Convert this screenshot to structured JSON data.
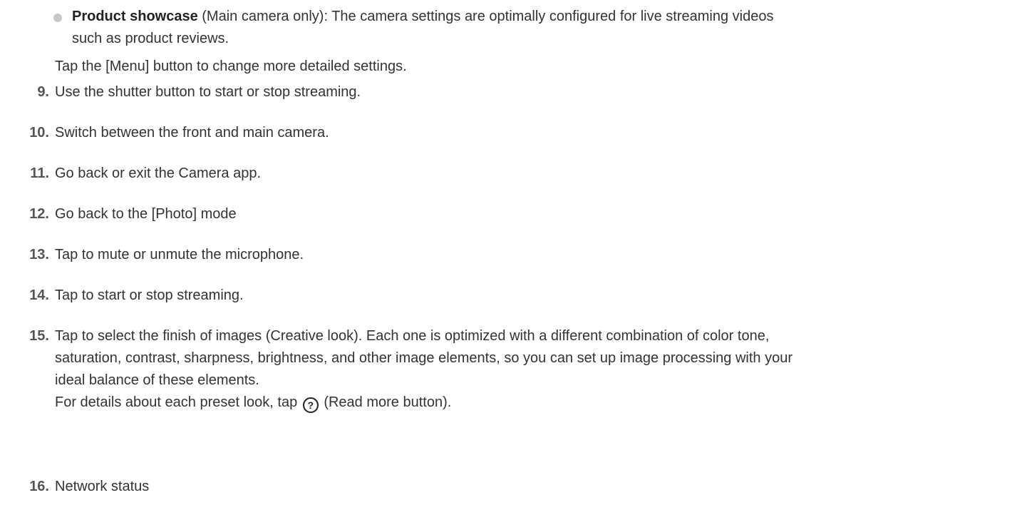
{
  "bullet": {
    "bold": "Product showcase",
    "line1": " (Main camera only): The camera settings are optimally configured for live streaming videos",
    "line2": "such as product reviews."
  },
  "note": "Tap the [Menu] button to change more detailed settings.",
  "steps": [
    {
      "num": "9.",
      "text": "Use the shutter button to start or stop streaming."
    },
    {
      "num": "10.",
      "text": "Switch between the front and main camera."
    },
    {
      "num": "11.",
      "text": "Go back or exit the Camera app."
    },
    {
      "num": "12.",
      "text": "Go back to the [Photo] mode"
    },
    {
      "num": "13.",
      "text": "Tap to mute or unmute the microphone."
    },
    {
      "num": "14.",
      "text": "Tap to start or stop streaming."
    },
    {
      "num": "15.",
      "line1": "Tap to select the finish of images (Creative look). Each one is optimized with a different combination of color tone,",
      "line2": "saturation, contrast, sharpness, brightness, and other image elements, so you can set up image processing with your",
      "line3": "ideal balance of these elements.",
      "detail_before": "For details about each preset look, tap ",
      "detail_icon": "?",
      "detail_after": " (Read more button)."
    },
    {
      "num": "16.",
      "text": "Network status"
    }
  ],
  "icons": {
    "help": "question-circle-icon"
  }
}
